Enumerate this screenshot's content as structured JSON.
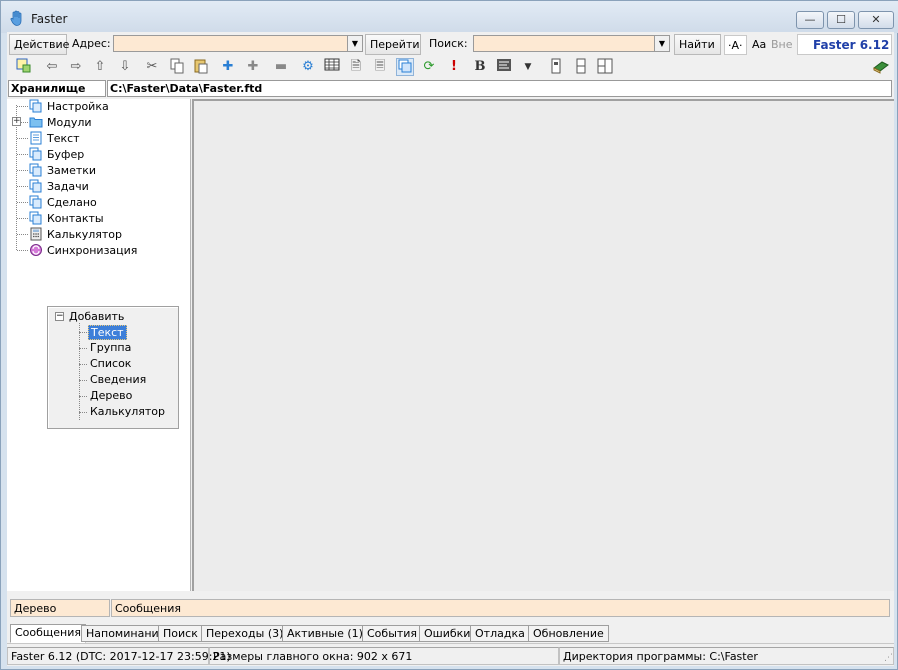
{
  "window": {
    "title": "Faster",
    "min_glyph": "—",
    "max_glyph": "☐",
    "close_glyph": "✕"
  },
  "address_bar": {
    "action_label": "Действие",
    "address_label": "Адрес:",
    "address_value": "",
    "go_label": "Перейти",
    "search_label": "Поиск:",
    "search_value": "",
    "find_label": "Найти",
    "font_a_label": "·A·",
    "font_aa_label": "Aa",
    "font_vne_label": "Вне",
    "version": "Faster 6.12"
  },
  "toolbar": {
    "icons": [
      "select-frame-icon",
      "back-arrow-icon",
      "forward-arrow-icon",
      "up-arrow-icon",
      "down-arrow-icon",
      "cut-icon",
      "copy-icon",
      "paste-icon",
      "add-plus-icon",
      "add-child-icon",
      "minus-icon",
      "settings-gear-icon",
      "table-icon",
      "page-icon",
      "page-lines-icon",
      "note-icon",
      "refresh-icon",
      "exclamation-icon",
      "bold-icon",
      "text-align-icon",
      "dropdown-arrow-icon",
      "split-vertical-icon",
      "column-icon",
      "split-horizontal-icon",
      "book-icon"
    ],
    "bold_glyph": "B",
    "exclamation_glyph": "!"
  },
  "path_bar": {
    "storage_label": "Хранилище",
    "path": "C:\\Faster\\Data\\Faster.ftd"
  },
  "tree": {
    "items": [
      {
        "label": "Настройка",
        "icon": "doc-stack-icon"
      },
      {
        "label": "Модули",
        "icon": "folder-icon"
      },
      {
        "label": "Текст",
        "icon": "text-doc-icon"
      },
      {
        "label": "Буфер",
        "icon": "doc-stack-icon"
      },
      {
        "label": "Заметки",
        "icon": "doc-stack-icon"
      },
      {
        "label": "Задачи",
        "icon": "doc-stack-icon"
      },
      {
        "label": "Сделано",
        "icon": "doc-stack-icon"
      },
      {
        "label": "Контакты",
        "icon": "doc-stack-icon"
      },
      {
        "label": "Калькулятор",
        "icon": "calculator-icon"
      },
      {
        "label": "Синхронизация",
        "icon": "sync-icon"
      }
    ],
    "expander_glyph": "+"
  },
  "add_popup": {
    "root_label": "Добавить",
    "collapse_glyph": "−",
    "items": [
      "Текст",
      "Группа",
      "Список",
      "Сведения",
      "Дерево",
      "Калькулятор"
    ],
    "selected": "Текст"
  },
  "bottom_bar": {
    "tree_label": "Дерево",
    "messages_label": "Сообщения"
  },
  "tabs": [
    {
      "label": "Сообщения",
      "active": true
    },
    {
      "label": "Напоминания",
      "active": false
    },
    {
      "label": "Поиск",
      "active": false
    },
    {
      "label": "Переходы (3)",
      "active": false
    },
    {
      "label": "Активные (1)",
      "active": false
    },
    {
      "label": "События",
      "active": false
    },
    {
      "label": "Ошибки",
      "active": false
    },
    {
      "label": "Отладка",
      "active": false
    },
    {
      "label": "Обновление",
      "active": false
    }
  ],
  "status": {
    "version_info": "Faster 6.12 (DTC: 2017-12-17 23:59:21)",
    "window_size": "Размеры главного окна: 902 x 671",
    "program_dir": "Директория программы: C:\\Faster"
  },
  "colors": {
    "accent_blue": "#1f3fa8",
    "input_bg": "#fde9d3",
    "selection": "#3d7fd9"
  }
}
